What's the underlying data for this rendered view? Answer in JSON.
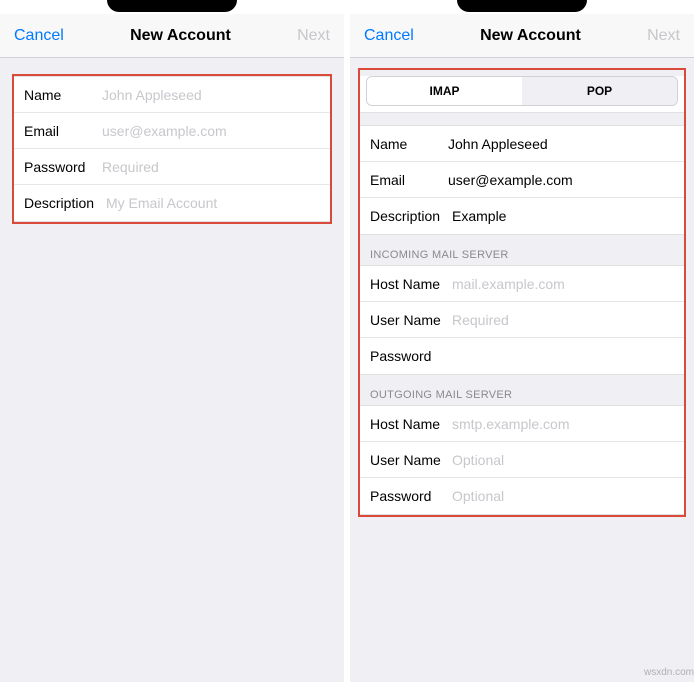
{
  "left": {
    "nav": {
      "cancel": "Cancel",
      "title": "New Account",
      "next": "Next"
    },
    "fields": {
      "name": {
        "label": "Name",
        "placeholder": "John Appleseed",
        "value": ""
      },
      "email": {
        "label": "Email",
        "placeholder": "user@example.com",
        "value": ""
      },
      "password": {
        "label": "Password",
        "placeholder": "Required",
        "value": ""
      },
      "description": {
        "label": "Description",
        "placeholder": "My Email Account",
        "value": ""
      }
    }
  },
  "right": {
    "nav": {
      "cancel": "Cancel",
      "title": "New Account",
      "next": "Next"
    },
    "segments": {
      "imap": "IMAP",
      "pop": "POP",
      "active": "IMAP"
    },
    "account": {
      "name": {
        "label": "Name",
        "value": "John Appleseed"
      },
      "email": {
        "label": "Email",
        "value": "user@example.com"
      },
      "description": {
        "label": "Description",
        "value": "Example"
      }
    },
    "incoming": {
      "header": "INCOMING MAIL SERVER",
      "host": {
        "label": "Host Name",
        "placeholder": "mail.example.com",
        "value": ""
      },
      "user": {
        "label": "User Name",
        "placeholder": "Required",
        "value": ""
      },
      "password": {
        "label": "Password",
        "placeholder": "",
        "value": ""
      }
    },
    "outgoing": {
      "header": "OUTGOING MAIL SERVER",
      "host": {
        "label": "Host Name",
        "placeholder": "smtp.example.com",
        "value": ""
      },
      "user": {
        "label": "User Name",
        "placeholder": "Optional",
        "value": ""
      },
      "password": {
        "label": "Password",
        "placeholder": "Optional",
        "value": ""
      }
    }
  },
  "watermark": "wsxdn.com"
}
